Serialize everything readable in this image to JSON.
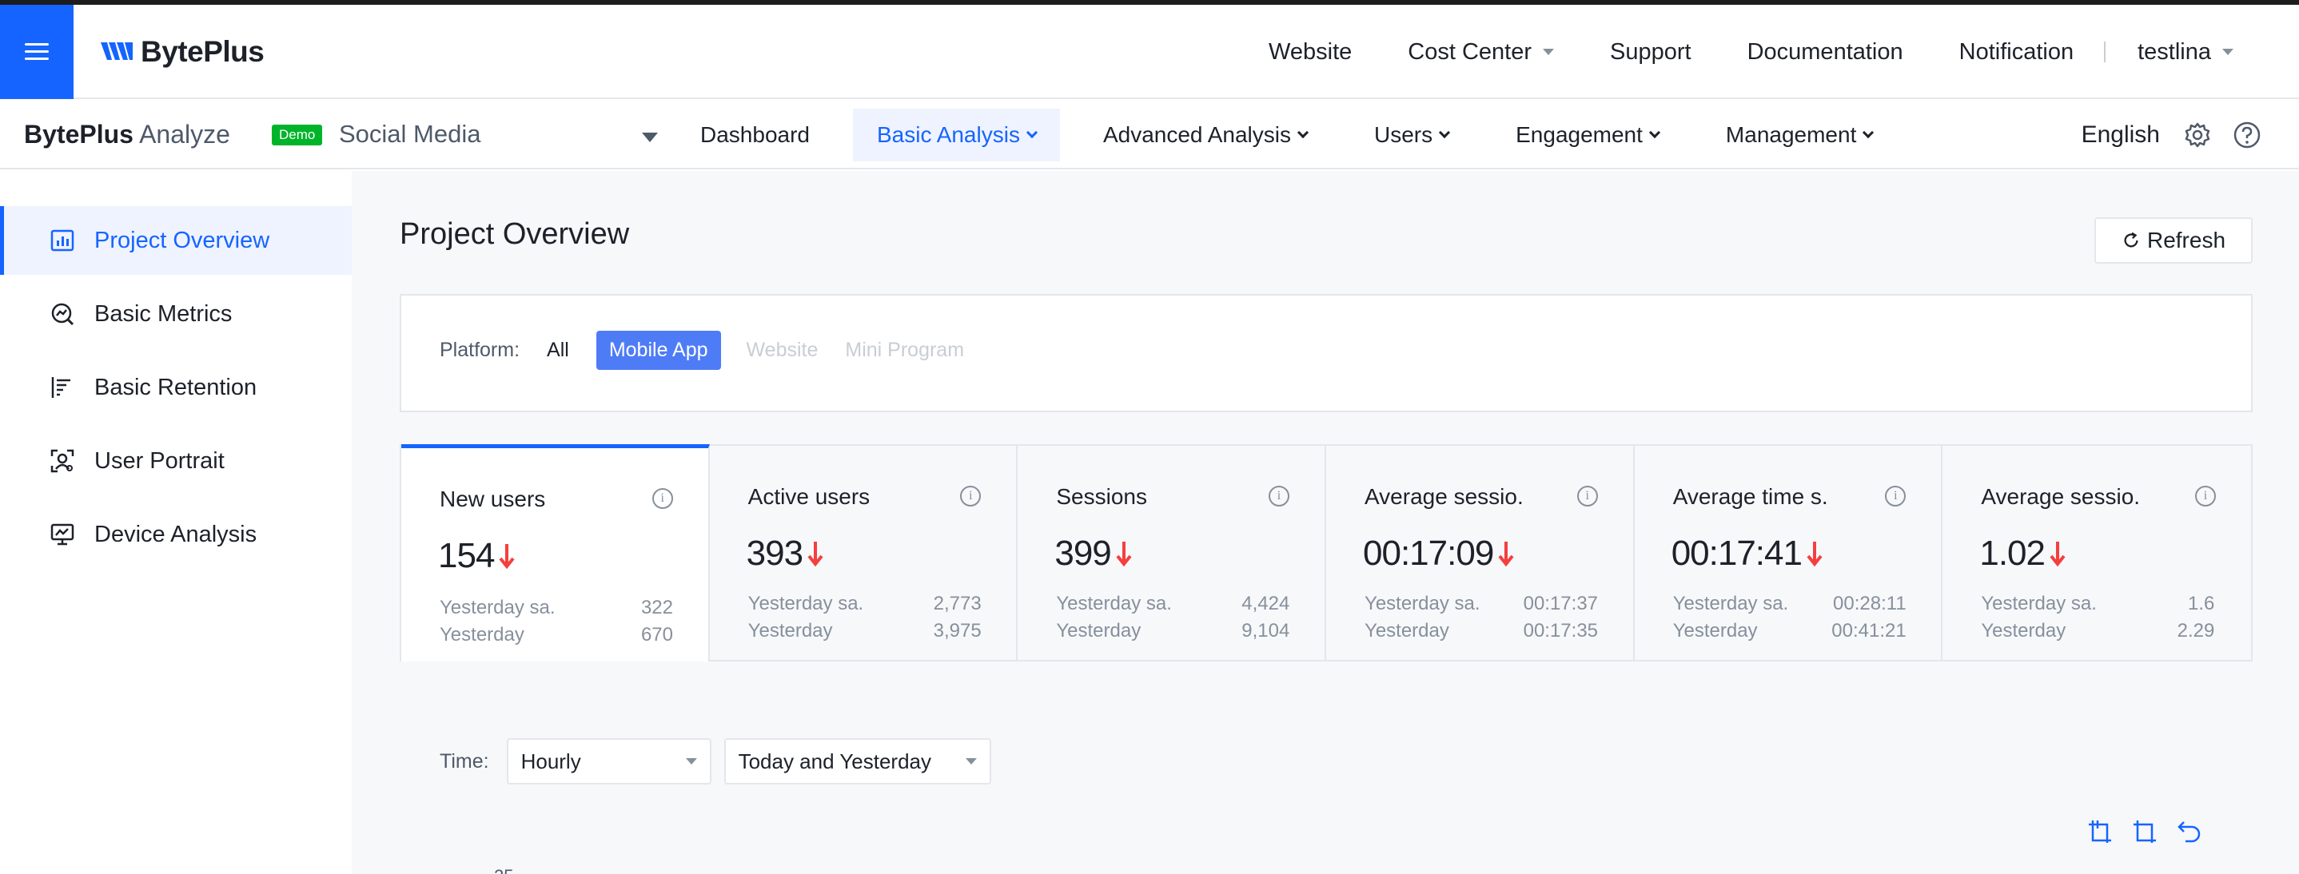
{
  "header": {
    "logo_text": "BytePlus",
    "nav": [
      {
        "label": "Website",
        "dropdown": false
      },
      {
        "label": "Cost Center",
        "dropdown": true
      },
      {
        "label": "Support",
        "dropdown": false
      },
      {
        "label": "Documentation",
        "dropdown": false
      },
      {
        "label": "Notification",
        "dropdown": false
      }
    ],
    "user": "testlina"
  },
  "subheader": {
    "brand_bold": "BytePlus",
    "brand_light": "Analyze",
    "badge": "Demo",
    "project": "Social Media",
    "nav": [
      {
        "label": "Dashboard",
        "active": false
      },
      {
        "label": "Basic Analysis",
        "active": true
      },
      {
        "label": "Advanced Analysis",
        "active": false
      },
      {
        "label": "Users",
        "active": false
      },
      {
        "label": "Engagement",
        "active": false
      },
      {
        "label": "Management",
        "active": false
      }
    ],
    "language": "English"
  },
  "sidebar": {
    "items": [
      {
        "label": "Project Overview",
        "icon": "bar-chart-icon",
        "active": true
      },
      {
        "label": "Basic Metrics",
        "icon": "search-chart-icon",
        "active": false
      },
      {
        "label": "Basic Retention",
        "icon": "retention-icon",
        "active": false
      },
      {
        "label": "User Portrait",
        "icon": "user-portrait-icon",
        "active": false
      },
      {
        "label": "Device Analysis",
        "icon": "device-icon",
        "active": false
      }
    ]
  },
  "main": {
    "title": "Project Overview",
    "refresh_label": "Refresh",
    "platform": {
      "label": "Platform:",
      "options": [
        "All",
        "Mobile App",
        "Website",
        "Mini Program"
      ],
      "selected": "Mobile App"
    },
    "metrics": [
      {
        "name": "New users",
        "value": "154",
        "trend": "down",
        "cmp1_label": "Yesterday sa.",
        "cmp1_value": "322",
        "cmp2_label": "Yesterday",
        "cmp2_value": "670"
      },
      {
        "name": "Active users",
        "value": "393",
        "trend": "down",
        "cmp1_label": "Yesterday sa.",
        "cmp1_value": "2,773",
        "cmp2_label": "Yesterday",
        "cmp2_value": "3,975"
      },
      {
        "name": "Sessions",
        "value": "399",
        "trend": "down",
        "cmp1_label": "Yesterday sa.",
        "cmp1_value": "4,424",
        "cmp2_label": "Yesterday",
        "cmp2_value": "9,104"
      },
      {
        "name": "Average sessio.",
        "value": "00:17:09",
        "trend": "down",
        "cmp1_label": "Yesterday sa.",
        "cmp1_value": "00:17:37",
        "cmp2_label": "Yesterday",
        "cmp2_value": "00:17:35"
      },
      {
        "name": "Average time s.",
        "value": "00:17:41",
        "trend": "down",
        "cmp1_label": "Yesterday sa.",
        "cmp1_value": "00:28:11",
        "cmp2_label": "Yesterday",
        "cmp2_value": "00:41:21"
      },
      {
        "name": "Average sessio.",
        "value": "1.02",
        "trend": "down",
        "cmp1_label": "Yesterday sa.",
        "cmp1_value": "1.6",
        "cmp2_label": "Yesterday",
        "cmp2_value": "2.29"
      }
    ],
    "time": {
      "label": "Time:",
      "granularity": "Hourly",
      "range": "Today and Yesterday"
    },
    "chart_y_top_tick": "25"
  },
  "colors": {
    "accent": "#1664ff",
    "down_arrow": "#f53f3f",
    "badge": "#00b42a"
  }
}
